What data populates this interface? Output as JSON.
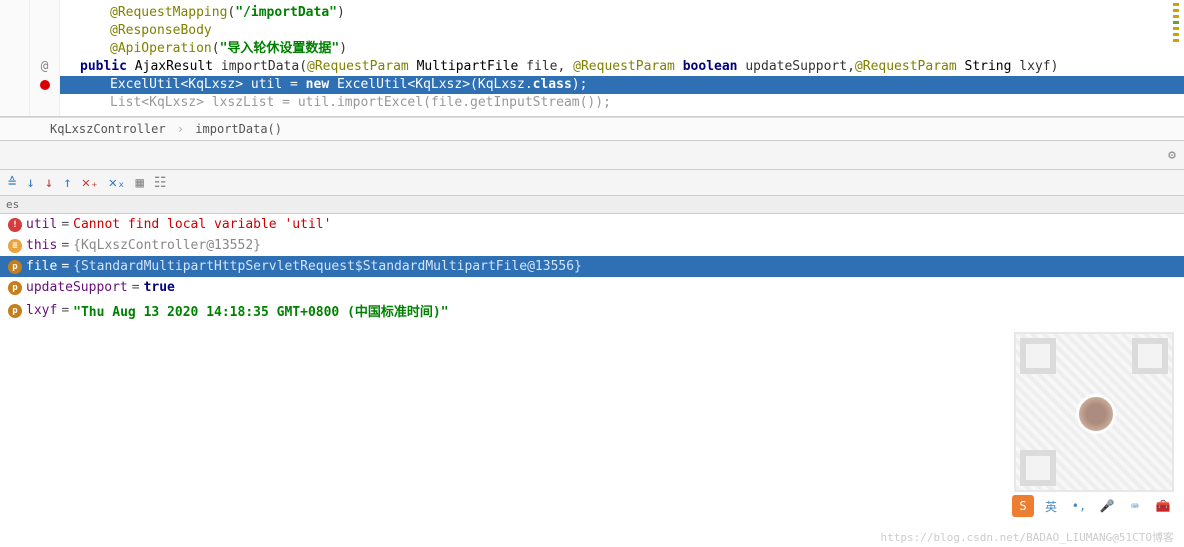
{
  "code": {
    "line1": {
      "ann": "@RequestMapping",
      "str": "\"/importData\""
    },
    "line2": {
      "ann": "@ResponseBody"
    },
    "line3": {
      "ann": "@ApiOperation",
      "str": "\"导入轮休设置数据\""
    },
    "line4": {
      "kw_public": "public",
      "type": "AjaxResult",
      "method": "importData",
      "ann1": "@RequestParam",
      "t1": "MultipartFile",
      "p1": "file",
      "ann2": "@RequestParam",
      "kw_bool": "boolean",
      "p2": "updateSupport",
      "ann3": "@RequestParam",
      "t3": "String",
      "p3": "lxyf"
    },
    "line5": {
      "text": "ExcelUtil<KqLxsz> util = ",
      "kw_new": "new",
      "rest": " ExcelUtil<KqLxsz>(KqLxsz.",
      "kw_cls": "class",
      "end": ");"
    },
    "line6": "List<KqLxsz> lxszList = util.importExcel(file.getInputStream());"
  },
  "gutter": {
    "visible": [
      "",
      "",
      "",
      "@",
      ""
    ],
    "bp_line": 5
  },
  "breadcrumb": {
    "a": "KqLxszController",
    "b": "importData()"
  },
  "tab": "es",
  "vars": [
    {
      "badge": "err",
      "name": "util",
      "eq": " = ",
      "val": "Cannot find local variable 'util'",
      "cls": "err"
    },
    {
      "badge": "obj",
      "name": "this",
      "eq": " = ",
      "val": "{KqLxszController@13552}",
      "cls": "obj"
    },
    {
      "badge": "p",
      "name": "file",
      "eq": " = ",
      "val": "{StandardMultipartHttpServletRequest$StandardMultipartFile@13556}",
      "cls": "obj",
      "sel": true
    },
    {
      "badge": "p",
      "name": "updateSupport",
      "eq": " = ",
      "val": "true",
      "cls": "true"
    },
    {
      "badge": "p",
      "name": "lxyf",
      "eq": " = ",
      "val": "\"Thu Aug 13 2020 14:18:35 GMT+0800 (中国标准时间)\"",
      "cls": "str"
    }
  ],
  "tray": {
    "sogou": "S",
    "lang": "英"
  },
  "watermark": "https://blog.csdn.net/BADAO_LIUMANG@51CTO博客"
}
